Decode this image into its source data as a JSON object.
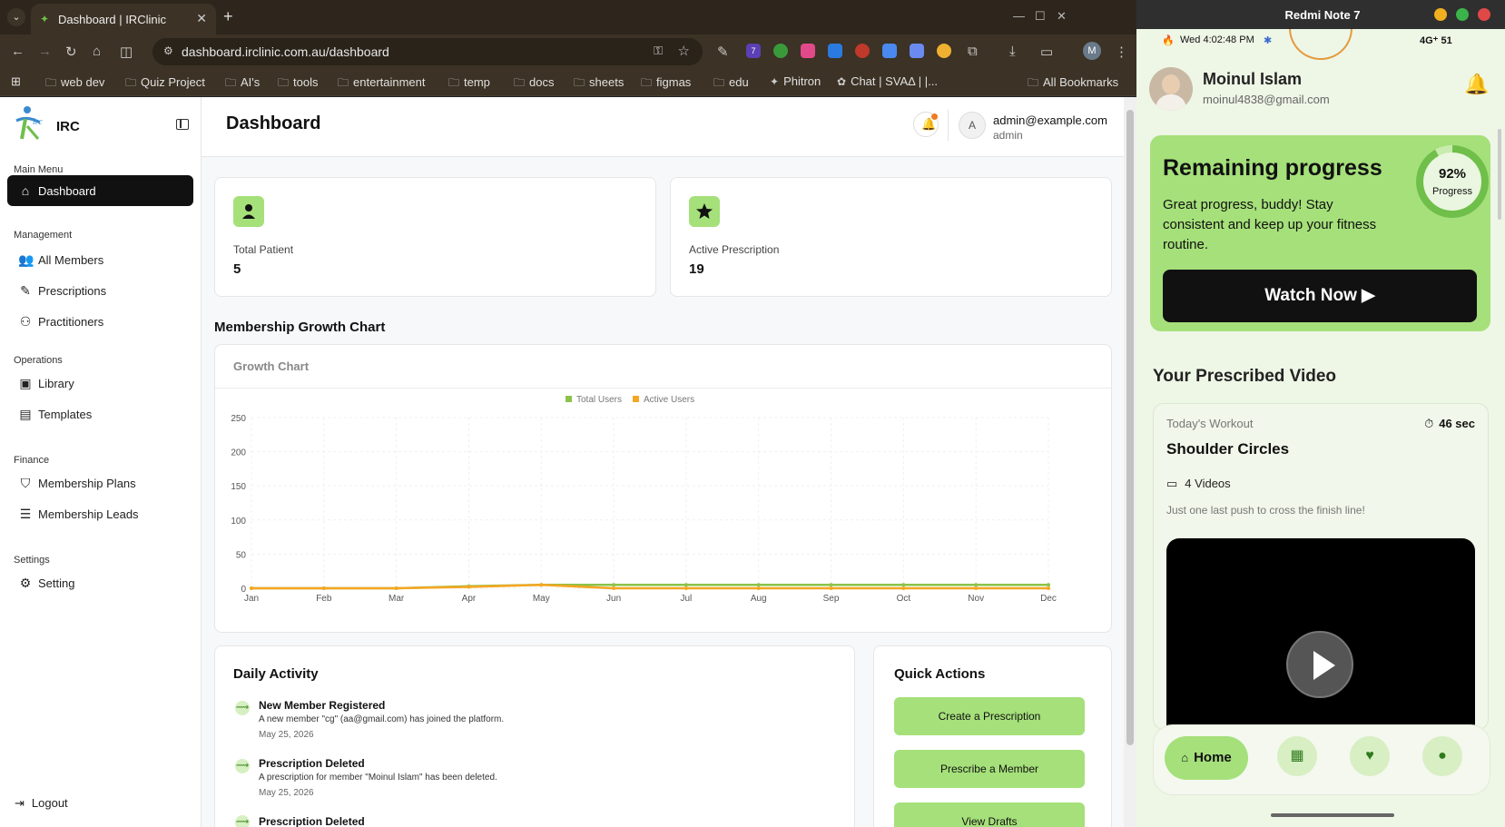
{
  "browser": {
    "tab_title": "Dashboard | IRClinic",
    "url": "dashboard.irclinic.com.au/dashboard",
    "bookmarks": [
      "web dev",
      "Quiz Project",
      "AI's",
      "tools",
      "entertainment",
      "temp",
      "docs",
      "sheets",
      "figmas",
      "edu",
      "Phitron",
      "Chat | SVAΔ | |...",
      "All Bookmarks"
    ],
    "profile_initial": "M",
    "ext_badge": "7"
  },
  "sidebar": {
    "brand": "IRC",
    "sections": {
      "main": "Main Menu",
      "management": "Management",
      "operations": "Operations",
      "finance": "Finance",
      "settings": "Settings"
    },
    "items": {
      "dashboard": "Dashboard",
      "members": "All Members",
      "prescriptions": "Prescriptions",
      "practitioners": "Practitioners",
      "library": "Library",
      "templates": "Templates",
      "plans": "Membership Plans",
      "leads": "Membership Leads",
      "setting": "Setting"
    },
    "logout": "Logout"
  },
  "header": {
    "title": "Dashboard",
    "avatar_initial": "A",
    "email": "admin@example.com",
    "role": "admin"
  },
  "stats": {
    "patients_label": "Total Patient",
    "patients_value": "5",
    "rx_label": "Active Prescription",
    "rx_value": "19"
  },
  "chart_section_title": "Membership Growth Chart",
  "chart_card_title": "Growth Chart",
  "chart_data": {
    "type": "line",
    "title": "Growth Chart",
    "categories": [
      "Jan",
      "Feb",
      "Mar",
      "Apr",
      "May",
      "Jun",
      "Jul",
      "Aug",
      "Sep",
      "Oct",
      "Nov",
      "Dec"
    ],
    "series": [
      {
        "name": "Total Users",
        "color": "#8bc34a",
        "values": [
          0,
          0,
          0,
          3,
          5,
          5,
          5,
          5,
          5,
          5,
          5,
          5
        ]
      },
      {
        "name": "Active Users",
        "color": "#f5a623",
        "values": [
          0,
          0,
          0,
          2,
          5,
          0,
          0,
          0,
          0,
          0,
          0,
          0
        ]
      }
    ],
    "yticks": [
      0,
      50,
      100,
      150,
      200,
      250
    ],
    "ylim": [
      0,
      250
    ],
    "grid": true,
    "legend": "top-center"
  },
  "activity": {
    "title": "Daily Activity",
    "items": [
      {
        "title": "New Member Registered",
        "desc": "A new member \"cg\" (aa@gmail.com) has joined the platform.",
        "date": "May 25, 2026"
      },
      {
        "title": "Prescription Deleted",
        "desc": "A prescription for member \"Moinul Islam\" has been deleted.",
        "date": "May 25, 2026"
      },
      {
        "title": "Prescription Deleted",
        "desc": "",
        "date": ""
      }
    ]
  },
  "quick_actions": {
    "title": "Quick Actions",
    "buttons": [
      "Create a Prescription",
      "Prescribe a Member",
      "View Drafts"
    ]
  },
  "phone": {
    "window_title": "Redmi Note 7",
    "status_time": "Wed 4:02:48 PM",
    "status_right": "4G⁺ 51",
    "user_name": "Moinul Islam",
    "user_email": "moinul4838@gmail.com",
    "progress_title": "Remaining progress",
    "progress_desc": "Great progress, buddy! Stay consistent and keep up your fitness routine.",
    "progress_percent": 92,
    "progress_value": "92%",
    "progress_label": "Progress",
    "watch_label": "Watch Now ▶",
    "prescribed_title": "Your Prescribed Video",
    "workout_label": "Today's Workout",
    "workout_time": "46 sec",
    "workout_name": "Shoulder Circles",
    "video_count": "4 Videos",
    "workout_note": "Just one last push to cross the finish line!",
    "home_label": "Home"
  },
  "colors": {
    "accent": "#a5e07a",
    "total_users": "#8bc34a",
    "active_users": "#f5a623"
  }
}
